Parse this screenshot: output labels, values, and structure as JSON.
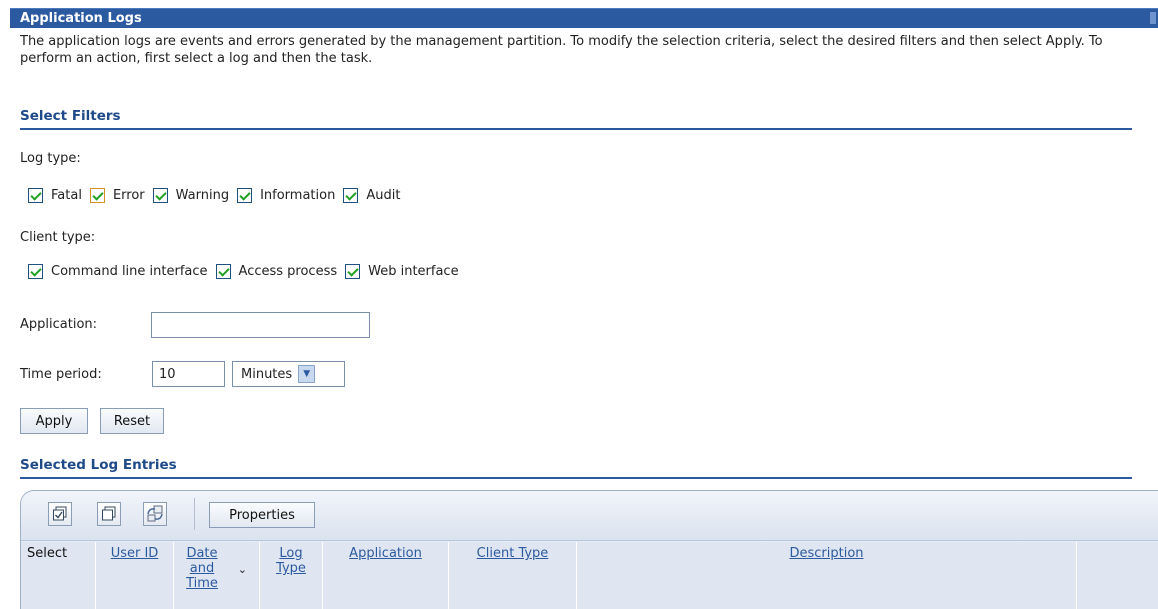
{
  "title": "Application Logs",
  "intro": "The application logs are events and errors generated by the management partition. To modify the selection criteria, select the desired filters and then select Apply. To perform an action, first select a log and then the task.",
  "filters": {
    "heading": "Select Filters",
    "log_type_label": "Log type:",
    "log_types": [
      "Fatal",
      "Error",
      "Warning",
      "Information",
      "Audit"
    ],
    "client_type_label": "Client type:",
    "client_types": [
      "Command line interface",
      "Access process",
      "Web interface"
    ],
    "application_label": "Application:",
    "application_value": "",
    "time_period_label": "Time period:",
    "time_period_value": "10",
    "time_unit": "Minutes",
    "apply_label": "Apply",
    "reset_label": "Reset"
  },
  "entries": {
    "heading": "Selected Log Entries",
    "properties_label": "Properties",
    "columns": {
      "select": "Select",
      "user_id": "User ID",
      "date_time": "Date and Time",
      "log_type": "Log Type",
      "application": "Application",
      "client_type": "Client Type",
      "description": "Description"
    }
  },
  "colors": {
    "title_bar": "#2c5aa0",
    "section_heading": "#1e4a8a",
    "checkbox_check": "#21a121",
    "checkbox_error_border": "#d68f22"
  },
  "icons": [
    "select-all-icon",
    "deselect-all-icon",
    "refresh-filter-icon",
    "sort-descending-icon"
  ]
}
